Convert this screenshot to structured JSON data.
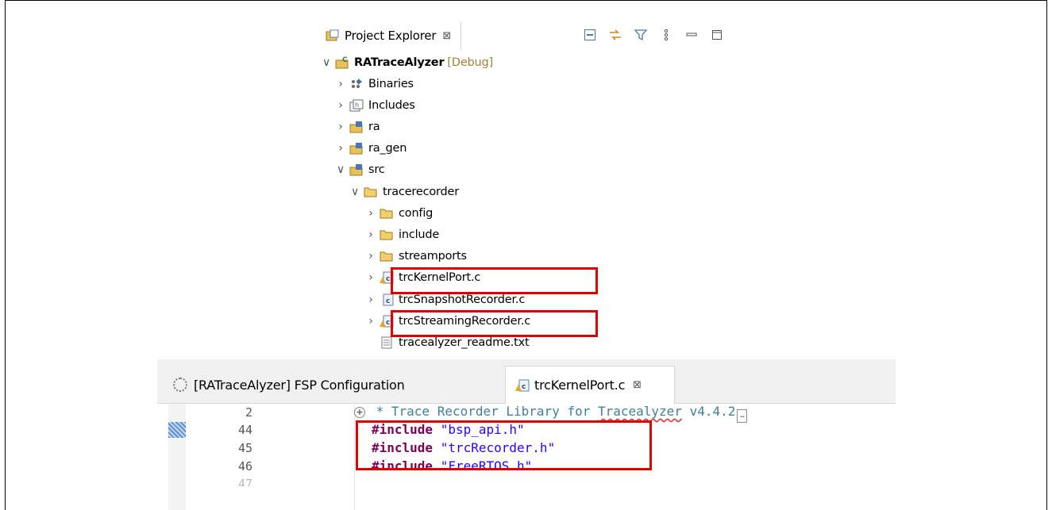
{
  "explorer": {
    "title": "Project Explorer",
    "close_glyph": "⊠",
    "tools": [
      "collapse-all-icon",
      "link-with-editor-icon",
      "filter-icon",
      "view-menu-icon",
      "minimize-icon",
      "maximize-icon"
    ],
    "project": {
      "name": "RATraceAlyzer",
      "config": "[Debug]"
    },
    "items": [
      {
        "label": "Binaries"
      },
      {
        "label": "Includes"
      },
      {
        "label": "ra"
      },
      {
        "label": "ra_gen"
      },
      {
        "label": "src"
      },
      {
        "label": "tracerecorder"
      },
      {
        "label": "config"
      },
      {
        "label": "include"
      },
      {
        "label": "streamports"
      },
      {
        "label": "trcKernelPort.c"
      },
      {
        "label": "trcSnapshotRecorder.c"
      },
      {
        "label": "trcStreamingRecorder.c"
      },
      {
        "label": "tracealyzer_readme.txt"
      }
    ]
  },
  "editor": {
    "tabs": [
      {
        "label": "[RATraceAlyzer] FSP Configuration"
      },
      {
        "label": "trcKernelPort.c"
      }
    ],
    "close_glyph": "⊠",
    "lines": [
      {
        "num": "2",
        "text": " * Trace Recorder Library for ",
        "link": "Tracealyzer",
        "tail": " v4.4.2"
      },
      {
        "num": "44",
        "kw": "#include",
        "str": "\"bsp_api.h\""
      },
      {
        "num": "45",
        "kw": "#include",
        "str": "\"trcRecorder.h\""
      },
      {
        "num": "46",
        "kw": "#include",
        "str": "\"FreeRTOS.h\""
      },
      {
        "num": "47"
      }
    ]
  }
}
